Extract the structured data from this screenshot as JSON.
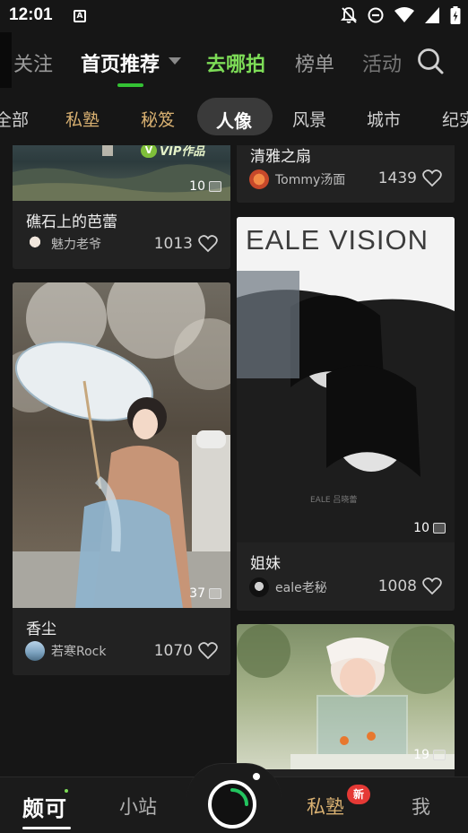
{
  "status_bar": {
    "time": "12:01",
    "notification_glyph": "A"
  },
  "top_tabs": {
    "items": [
      {
        "label": "关注"
      },
      {
        "label": "首页推荐"
      },
      {
        "label": "去哪拍"
      },
      {
        "label": "榜单"
      },
      {
        "label": "活动"
      }
    ]
  },
  "categories": [
    {
      "label": "全部"
    },
    {
      "label": "私塾"
    },
    {
      "label": "秘笈"
    },
    {
      "label": "人像"
    },
    {
      "label": "风景"
    },
    {
      "label": "城市"
    },
    {
      "label": "纪实"
    }
  ],
  "feed": {
    "left": [
      {
        "title": "礁石上的芭蕾",
        "author": "魅力老爷",
        "likes": "1013",
        "image_count": "10",
        "watermark": "VIP作品"
      },
      {
        "title": "香尘",
        "author": "若寒Rock",
        "likes": "1070",
        "image_count": "37"
      }
    ],
    "right": [
      {
        "title": "清雅之扇",
        "author": "Tommy汤面",
        "likes": "1439"
      },
      {
        "title": "姐妹",
        "author": "eale老秘",
        "likes": "1008",
        "image_count": "10",
        "brand_text": "EALE VISION",
        "brand_small": "EALE 吕晓蕾"
      },
      {
        "title": "",
        "author": "",
        "likes": "",
        "image_count": "19"
      }
    ]
  },
  "bottom_nav": {
    "logo": "颇可",
    "items": [
      {
        "label": "小站"
      },
      {
        "label": "私塾",
        "badge": "新"
      },
      {
        "label": "我"
      }
    ]
  },
  "colors": {
    "background": "#161616",
    "card": "#222222",
    "accent_green": "#7ddc57",
    "gold": "#d8b071",
    "badge_red": "#e53935"
  }
}
